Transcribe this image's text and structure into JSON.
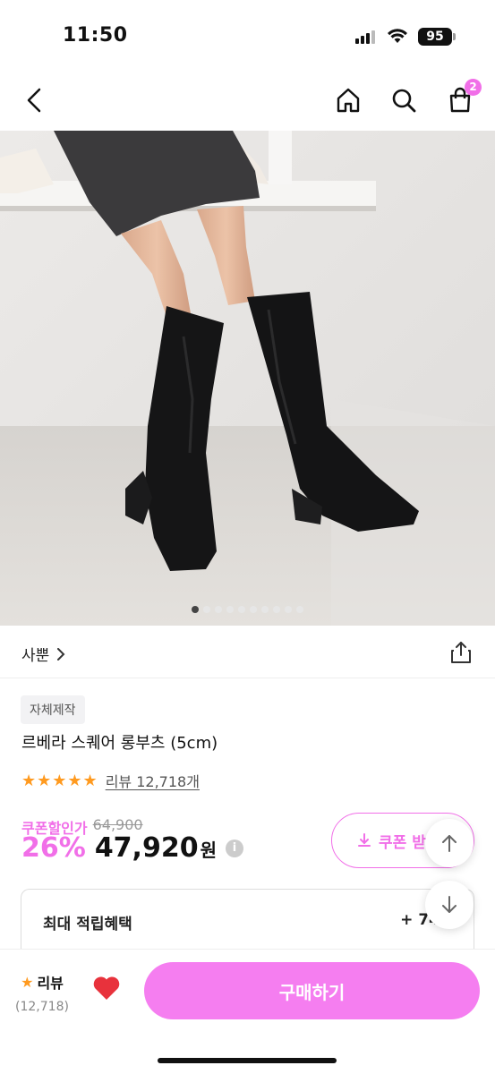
{
  "status": {
    "time": "11:50",
    "battery": "95"
  },
  "nav": {
    "cart_count": "2"
  },
  "image": {
    "slide_count": 10,
    "active_slide": 0
  },
  "store": {
    "name": "사뿐"
  },
  "product": {
    "tag": "자체제작",
    "title": "르베라 스퀘어 롱부츠 (5cm)",
    "stars": "★★★★★",
    "review_link": "리뷰 12,718개",
    "coupon_label": "쿠폰할인가",
    "original_price": "64,900",
    "discount": "26%",
    "price": "47,920",
    "currency": "원",
    "info_icon": "i"
  },
  "coupon_button": {
    "label": "쿠폰 받"
  },
  "benefit": {
    "label": "최대 적립혜택",
    "value": "+ 74"
  },
  "bottom": {
    "review_label": "리뷰",
    "review_count": "(12,718)",
    "buy_label": "구매하기"
  },
  "colors": {
    "accent": "#f16fe8",
    "buy_button": "#f57ef0",
    "star": "#ff9a1f",
    "heart": "#e8323c"
  },
  "icons": [
    "back-icon",
    "home-icon",
    "search-icon",
    "cart-icon",
    "share-icon",
    "chevron-right-icon",
    "download-icon",
    "arrow-up-icon",
    "arrow-down-icon",
    "heart-icon",
    "info-icon"
  ]
}
